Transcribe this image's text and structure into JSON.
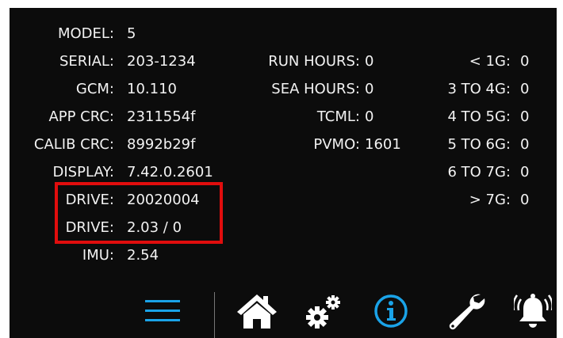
{
  "left_column": [
    {
      "label": "MODEL:",
      "value": "5"
    },
    {
      "label": "SERIAL:",
      "value": "203-1234"
    },
    {
      "label": "GCM:",
      "value": "10.110"
    },
    {
      "label": "APP CRC:",
      "value": "2311554f"
    },
    {
      "label": "CALIB CRC:",
      "value": "8992b29f"
    },
    {
      "label": "DISPLAY:",
      "value": "7.42.0.2601"
    },
    {
      "label": "DRIVE:",
      "value": "20020004"
    },
    {
      "label": "DRIVE:",
      "value": "2.03 / 0"
    },
    {
      "label": "IMU:",
      "value": "2.54"
    }
  ],
  "middle_column": [
    {
      "label": "RUN HOURS:",
      "value": "0"
    },
    {
      "label": "SEA HOURS:",
      "value": "0"
    },
    {
      "label": "TCML:",
      "value": "0"
    },
    {
      "label": "PVMO:",
      "value": "1601"
    }
  ],
  "right_column": [
    {
      "label": "< 1G:",
      "value": "0"
    },
    {
      "label": "3 TO 4G:",
      "value": "0"
    },
    {
      "label": "4 TO 5G:",
      "value": "0"
    },
    {
      "label": "5 TO 6G:",
      "value": "0"
    },
    {
      "label": "6 TO 7G:",
      "value": "0"
    },
    {
      "label": "> 7G:",
      "value": "0"
    }
  ],
  "toolbar": {
    "icons": [
      "menu-icon",
      "home-icon",
      "settings-gears-icon",
      "info-icon",
      "wrench-icon",
      "alarm-bell-icon"
    ],
    "active_color": "#1aa3e8",
    "inactive_color": "#ffffff"
  },
  "colors": {
    "background": "#0c0c0c",
    "text": "#f2f2f2",
    "highlight": "#e10d0d"
  }
}
